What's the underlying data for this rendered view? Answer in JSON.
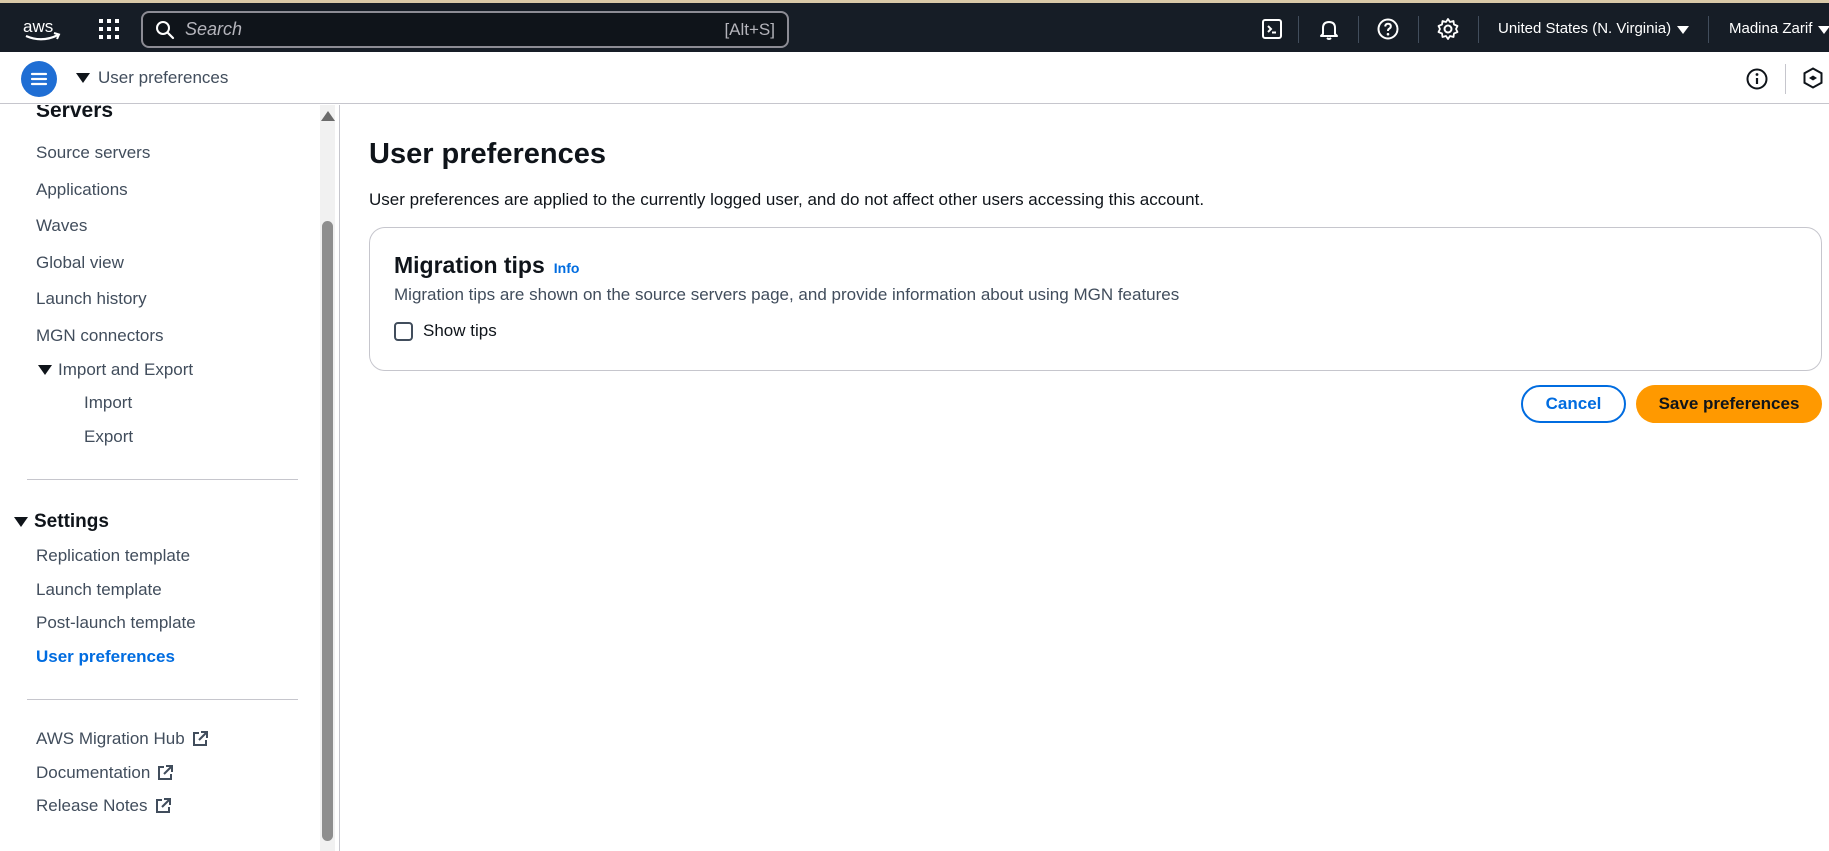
{
  "topbar": {
    "logo_text": "aws",
    "search_placeholder": "Search",
    "search_shortcut": "[Alt+S]",
    "icons": [
      "cloudshell-icon",
      "bell-icon",
      "help-icon",
      "settings-icon"
    ],
    "region": "United States (N. Virginia)",
    "user": "Madina Zarif"
  },
  "breadcrumb": {
    "current": "User preferences"
  },
  "sidebar": {
    "servers_heading": "Servers",
    "server_items": [
      "Source servers",
      "Applications",
      "Waves",
      "Global view",
      "Launch history",
      "MGN connectors"
    ],
    "import_export": "Import and Export",
    "import": "Import",
    "export": "Export",
    "settings_heading": "Settings",
    "settings_items": [
      "Replication template",
      "Launch template",
      "Post-launch template",
      "User preferences"
    ],
    "active_item": "User preferences",
    "external_links": [
      "AWS Migration Hub",
      "Documentation",
      "Release Notes"
    ]
  },
  "main": {
    "title": "User preferences",
    "description": "User preferences are applied to the currently logged user, and do not affect other users accessing this account.",
    "panel": {
      "title": "Migration tips",
      "info_link": "Info",
      "description": "Migration tips are shown on the source servers page, and provide information about using MGN features",
      "checkbox_label": "Show tips",
      "checkbox_checked": false
    },
    "cancel_label": "Cancel",
    "save_label": "Save preferences"
  },
  "colors": {
    "nav_bg": "#161d26",
    "accent_blue": "#006ce0",
    "primary_orange": "#ff9900"
  }
}
